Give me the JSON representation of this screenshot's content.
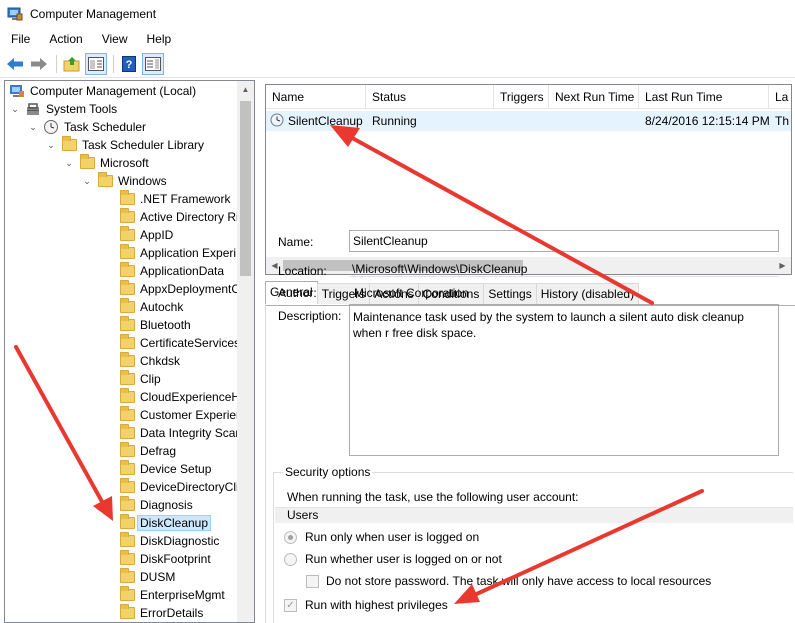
{
  "window": {
    "title": "Computer Management"
  },
  "menu": {
    "items": [
      "File",
      "Action",
      "View",
      "Help"
    ]
  },
  "toolbar": {
    "buttons": [
      "back-icon",
      "forward-icon",
      "up-folder-icon",
      "show-hide-tree-icon",
      "help-icon",
      "show-action-pane-icon"
    ]
  },
  "tree": {
    "items": [
      {
        "label": "Computer Management (Local)",
        "icon": "computer-icon",
        "chev": ""
      },
      {
        "label": "System Tools",
        "icon": "tools-icon",
        "chev": "▼"
      },
      {
        "label": "Task Scheduler",
        "icon": "clock-icon",
        "chev": "▼"
      },
      {
        "label": "Task Scheduler Library",
        "icon": "folder-icon",
        "chev": "▼"
      },
      {
        "label": "Microsoft",
        "icon": "folder-icon",
        "chev": "▼"
      },
      {
        "label": "Windows",
        "icon": "folder-icon",
        "chev": "▼"
      },
      {
        "label": ".NET Framework",
        "icon": "folder-icon"
      },
      {
        "label": "Active Directory Ri",
        "icon": "folder-icon"
      },
      {
        "label": "AppID",
        "icon": "folder-icon"
      },
      {
        "label": "Application Experi",
        "icon": "folder-icon"
      },
      {
        "label": "ApplicationData",
        "icon": "folder-icon"
      },
      {
        "label": "AppxDeploymentC",
        "icon": "folder-icon"
      },
      {
        "label": "Autochk",
        "icon": "folder-icon"
      },
      {
        "label": "Bluetooth",
        "icon": "folder-icon"
      },
      {
        "label": "CertificateServices",
        "icon": "folder-icon"
      },
      {
        "label": "Chkdsk",
        "icon": "folder-icon"
      },
      {
        "label": "Clip",
        "icon": "folder-icon"
      },
      {
        "label": "CloudExperienceH",
        "icon": "folder-icon"
      },
      {
        "label": "Customer Experier",
        "icon": "folder-icon"
      },
      {
        "label": "Data Integrity Scar",
        "icon": "folder-icon"
      },
      {
        "label": "Defrag",
        "icon": "folder-icon"
      },
      {
        "label": "Device Setup",
        "icon": "folder-icon"
      },
      {
        "label": "DeviceDirectoryCli",
        "icon": "folder-icon"
      },
      {
        "label": "Diagnosis",
        "icon": "folder-icon"
      },
      {
        "label": "DiskCleanup",
        "icon": "folder-icon",
        "selected": true
      },
      {
        "label": "DiskDiagnostic",
        "icon": "folder-icon"
      },
      {
        "label": "DiskFootprint",
        "icon": "folder-icon"
      },
      {
        "label": "DUSM",
        "icon": "folder-icon"
      },
      {
        "label": "EnterpriseMgmt",
        "icon": "folder-icon"
      },
      {
        "label": "ErrorDetails",
        "icon": "folder-icon"
      }
    ]
  },
  "task_list": {
    "columns": [
      "Name",
      "Status",
      "Triggers",
      "Next Run Time",
      "Last Run Time",
      "La"
    ],
    "rows": [
      {
        "name": "SilentCleanup",
        "status": "Running",
        "triggers": "",
        "next_run": "",
        "last_run": "8/24/2016 12:15:14 PM",
        "last_result": "Th"
      }
    ]
  },
  "tabs": [
    "General",
    "Triggers",
    "Actions",
    "Conditions",
    "Settings",
    "History (disabled)"
  ],
  "general": {
    "name_label": "Name:",
    "name_value": "SilentCleanup",
    "location_label": "Location:",
    "location_value": "\\Microsoft\\Windows\\DiskCleanup",
    "author_label": "Author:",
    "author_value": "Microsoft Corporation",
    "description_label": "Description:",
    "description_value": "Maintenance task used by the system to launch a silent auto disk cleanup when r free disk space."
  },
  "security": {
    "legend": "Security options",
    "account_prompt": "When running the task, use the following user account:",
    "account": "Users",
    "radio_logged_on": "Run only when user is logged on",
    "radio_logged_on_or_not": "Run whether user is logged on or not",
    "check_no_store": "Do not store password.  The task will only have access to local resources",
    "check_highest": "Run with highest privileges"
  },
  "annotation": {
    "arrow_color": "#e8382f"
  }
}
